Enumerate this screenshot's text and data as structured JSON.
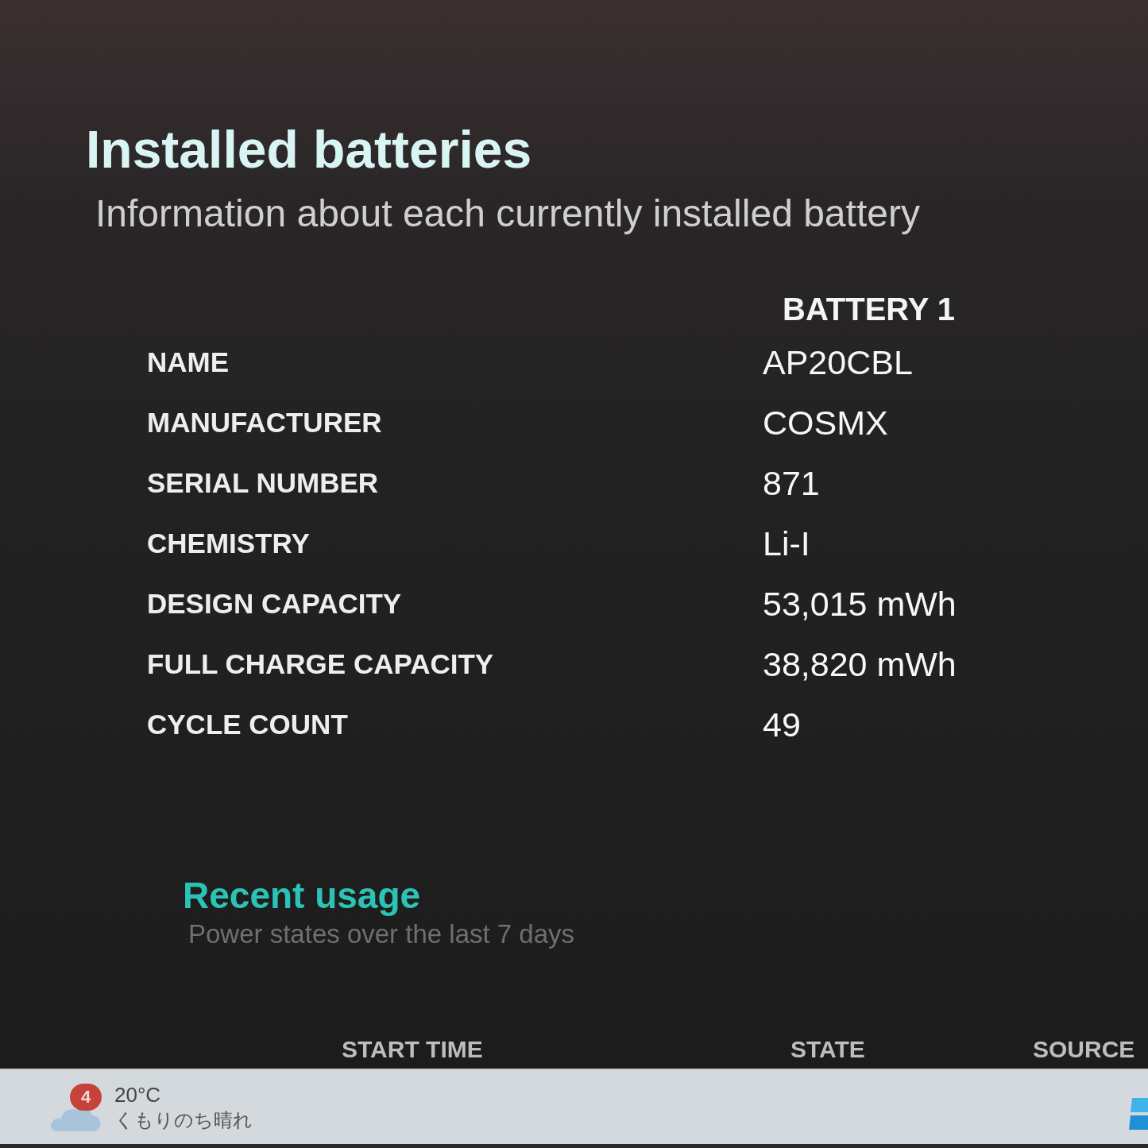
{
  "report": {
    "title": "Installed batteries",
    "subtitle": "Information about each currently installed battery",
    "battery_header": "BATTERY 1",
    "rows": [
      {
        "label": "NAME",
        "value": "AP20CBL"
      },
      {
        "label": "MANUFACTURER",
        "value": "COSMX"
      },
      {
        "label": "SERIAL NUMBER",
        "value": "871"
      },
      {
        "label": "CHEMISTRY",
        "value": "Li-I"
      },
      {
        "label": "DESIGN CAPACITY",
        "value": "53,015 mWh"
      },
      {
        "label": "FULL CHARGE CAPACITY",
        "value": "38,820 mWh"
      },
      {
        "label": "CYCLE COUNT",
        "value": "49"
      }
    ]
  },
  "recent_usage": {
    "title": "Recent usage",
    "subtitle": "Power states over the last 7 days",
    "columns": [
      "START TIME",
      "STATE",
      "SOURCE"
    ]
  },
  "taskbar": {
    "weather": {
      "badge": "4",
      "temperature": "20°C",
      "condition": "くもりのち晴れ"
    }
  }
}
